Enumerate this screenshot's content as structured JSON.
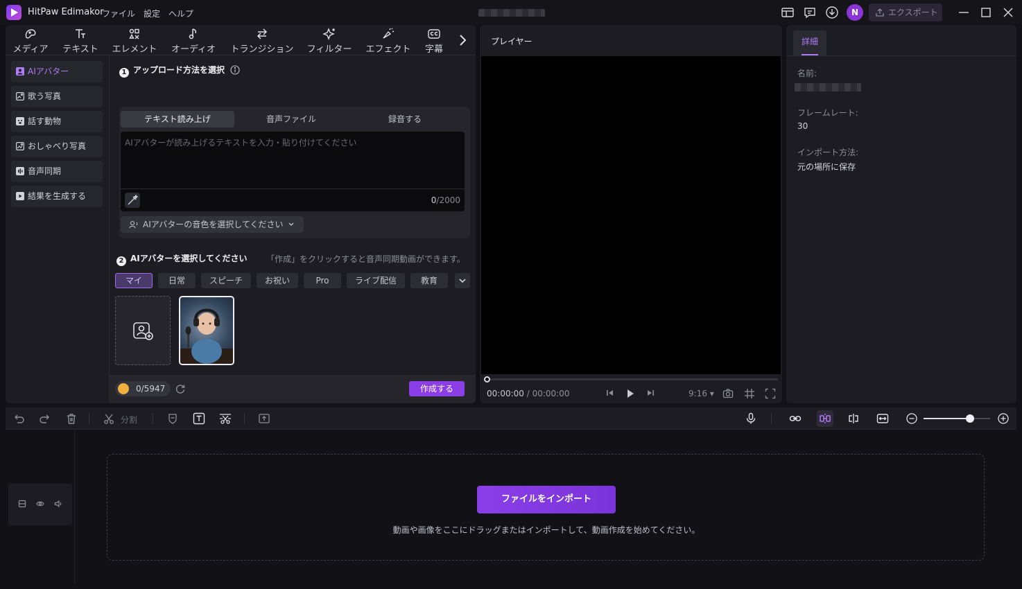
{
  "app": {
    "title": "HitPaw Edimakor",
    "menus": [
      "ファイル",
      "設定",
      "ヘルプ"
    ],
    "avatar_letter": "N",
    "export_label": "エクスポート"
  },
  "tool_tabs": [
    {
      "label": "メディア",
      "icon": "media-icon"
    },
    {
      "label": "テキスト",
      "icon": "text-icon"
    },
    {
      "label": "エレメント",
      "icon": "element-icon"
    },
    {
      "label": "オーディオ",
      "icon": "audio-icon"
    },
    {
      "label": "トランジション",
      "icon": "transition-icon"
    },
    {
      "label": "フィルター",
      "icon": "filter-icon"
    },
    {
      "label": "エフェクト",
      "icon": "effect-icon"
    },
    {
      "label": "字幕",
      "icon": "subtitle-icon"
    }
  ],
  "side_nav": [
    {
      "label": "AIアバター",
      "active": true
    },
    {
      "label": "歌う写真",
      "active": false
    },
    {
      "label": "話す動物",
      "active": false
    },
    {
      "label": "おしゃべり写真",
      "active": false
    },
    {
      "label": "音声同期",
      "active": false
    },
    {
      "label": "結果を生成する",
      "active": false
    }
  ],
  "step1": {
    "num": "1",
    "title": "アップロード方法を選択"
  },
  "upload_tabs": [
    {
      "label": "テキスト読み上げ",
      "active": true
    },
    {
      "label": "音声ファイル",
      "active": false
    },
    {
      "label": "録音する",
      "active": false
    }
  ],
  "text_input": {
    "placeholder": "AIアバターが読み上げるテキストを入力・貼り付けてください",
    "count": "0",
    "max": "/2000"
  },
  "voice_select": "AIアバターの音色を選択してください",
  "step2": {
    "num": "2",
    "title": "AIアバターを選択してください",
    "hint": "「作成」をクリックすると音声同期動画ができます。"
  },
  "categories": [
    {
      "label": "マイ",
      "active": true
    },
    {
      "label": "日常",
      "active": false
    },
    {
      "label": "スピーチ",
      "active": false
    },
    {
      "label": "お祝い",
      "active": false
    },
    {
      "label": "Pro",
      "active": false
    },
    {
      "label": "ライブ配信",
      "active": false
    },
    {
      "label": "教育",
      "active": false
    }
  ],
  "footer": {
    "credits": "0/5947",
    "create_label": "作成する"
  },
  "player": {
    "title": "プレイヤー",
    "time_current": "00:00:00",
    "time_total": " / 00:00:00",
    "ratio": "9:16"
  },
  "details": {
    "tab": "詳細",
    "name_label": "名前:",
    "framerate_label": "フレームレート:",
    "framerate_value": "30",
    "import_label": "インポート方法:",
    "import_value": "元の場所に保存"
  },
  "timeline": {
    "split_label": "分割",
    "import_button": "ファイルをインポート",
    "hint": "動画や画像をここにドラッグまたはインポートして、動画作成を始めてください。",
    "zoom_level": 0.7
  },
  "colors": {
    "accent": "#8b3ee6",
    "accent_text": "#b07cf5",
    "bg": "#111116",
    "panel": "#1c1c22"
  }
}
